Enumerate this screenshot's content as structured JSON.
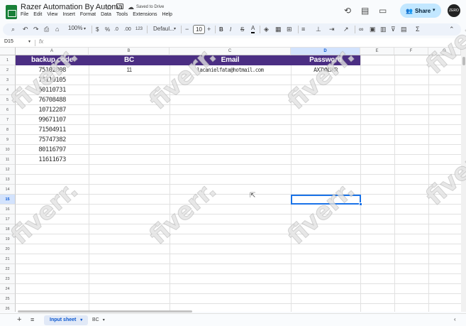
{
  "doc": {
    "title": "Razer Automation By Automa",
    "saved_status": "Saved to Drive"
  },
  "menus": [
    "File",
    "Edit",
    "View",
    "Insert",
    "Format",
    "Data",
    "Tools",
    "Extensions",
    "Help"
  ],
  "toolbar": {
    "zoom": "100%",
    "currency": "$",
    "percent": "%",
    "dec_decrease": ".0",
    "dec_increase": ".00",
    "number_format": "123",
    "font": "Defaul...",
    "font_size": "10",
    "bold": "B",
    "italic": "I",
    "strike": "S",
    "text_color": "A",
    "sum": "Σ"
  },
  "share": {
    "label": "Share"
  },
  "avatar": {
    "label": "ZERO"
  },
  "formula_bar": {
    "name_box": "D15",
    "fx": "fx"
  },
  "columns": [
    "A",
    "B",
    "C",
    "D",
    "E",
    "F",
    "G"
  ],
  "rows": [
    "1",
    "2",
    "3",
    "4",
    "5",
    "6",
    "7",
    "8",
    "9",
    "10",
    "11",
    "12",
    "13",
    "14",
    "15",
    "16",
    "17",
    "18",
    "19",
    "20",
    "21",
    "22",
    "23",
    "24",
    "25",
    "26",
    "27",
    "28",
    "29",
    "30",
    "31"
  ],
  "selected": {
    "column": "D",
    "row": "15"
  },
  "sheet": {
    "headers": [
      "backup code",
      "BC",
      "Email",
      "Password"
    ],
    "row2": {
      "bc": "11",
      "email": "lacanielfata@hotmail.com",
      "password": "AX7YNJKR"
    },
    "backup_codes": [
      "75102808",
      "75110105",
      "50110731",
      "76708488",
      "10712287",
      "99671107",
      "71504911",
      "75747382",
      "80116797",
      "11611673"
    ]
  },
  "tabs": {
    "active": "Input sheet",
    "other": "BC"
  },
  "watermark": "fiverr."
}
